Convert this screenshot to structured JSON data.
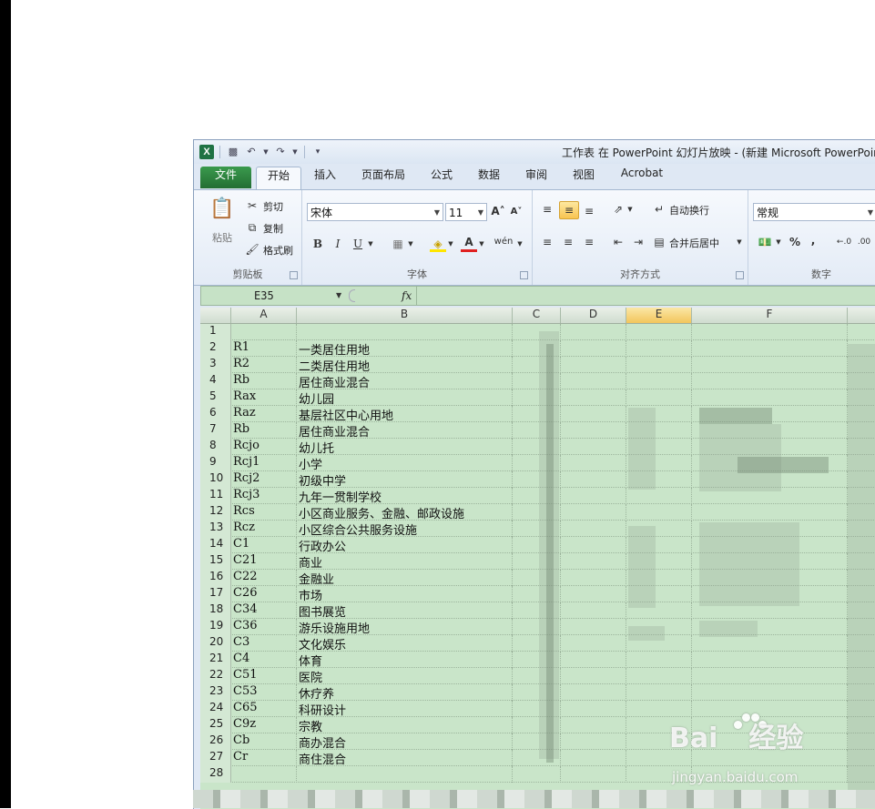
{
  "window": {
    "title": "工作表 在 PowerPoint 幻灯片放映 - (新建 Microsoft PowerPoint",
    "app_icon_letter": "X"
  },
  "qat": {
    "save_icon": "save-icon",
    "undo_icon": "undo-icon",
    "redo_icon": "redo-icon",
    "customize_icon": "customize-qat-icon"
  },
  "tabs": [
    "文件",
    "开始",
    "插入",
    "页面布局",
    "公式",
    "数据",
    "审阅",
    "视图",
    "Acrobat"
  ],
  "ribbon": {
    "clipboard": {
      "paste": "粘贴",
      "cut": "剪切",
      "copy": "复制",
      "format_painter": "格式刷",
      "label": "剪贴板"
    },
    "font": {
      "name": "宋体",
      "size": "11",
      "bold": "B",
      "italic": "I",
      "underline": "U",
      "label": "字体",
      "phonetic": "wén"
    },
    "alignment": {
      "wrap_text": "自动换行",
      "merge_center": "合并后居中",
      "label": "对齐方式"
    },
    "number": {
      "format": "常规",
      "percent": "%",
      "comma": ",",
      "label": "数字"
    }
  },
  "formula_bar": {
    "name_box": "E35",
    "fx": "fx",
    "formula": ""
  },
  "columns": [
    "A",
    "B",
    "C",
    "D",
    "E",
    "F"
  ],
  "selected_column": "E",
  "rows": [
    {
      "n": "1",
      "a": "",
      "b": ""
    },
    {
      "n": "2",
      "a": "R1",
      "b": "一类居住用地"
    },
    {
      "n": "3",
      "a": "R2",
      "b": "二类居住用地"
    },
    {
      "n": "4",
      "a": "Rb",
      "b": "居住商业混合"
    },
    {
      "n": "5",
      "a": "Rax",
      "b": "幼儿园"
    },
    {
      "n": "6",
      "a": "Raz",
      "b": "基层社区中心用地"
    },
    {
      "n": "7",
      "a": "Rb",
      "b": "居住商业混合"
    },
    {
      "n": "8",
      "a": "Rcjo",
      "b": "幼儿托"
    },
    {
      "n": "9",
      "a": "Rcj1",
      "b": "小学"
    },
    {
      "n": "10",
      "a": "Rcj2",
      "b": "初级中学"
    },
    {
      "n": "11",
      "a": "Rcj3",
      "b": "九年一贯制学校"
    },
    {
      "n": "12",
      "a": "Rcs",
      "b": "小区商业服务、金融、邮政设施"
    },
    {
      "n": "13",
      "a": "Rcz",
      "b": "小区综合公共服务设施"
    },
    {
      "n": "14",
      "a": "C1",
      "b": "行政办公"
    },
    {
      "n": "15",
      "a": "C21",
      "b": "商业"
    },
    {
      "n": "16",
      "a": "C22",
      "b": "金融业"
    },
    {
      "n": "17",
      "a": "C26",
      "b": "市场"
    },
    {
      "n": "18",
      "a": "C34",
      "b": "图书展览"
    },
    {
      "n": "19",
      "a": "C36",
      "b": "游乐设施用地"
    },
    {
      "n": "20",
      "a": "C3",
      "b": "文化娱乐"
    },
    {
      "n": "21",
      "a": "C4",
      "b": "体育"
    },
    {
      "n": "22",
      "a": "C51",
      "b": "医院"
    },
    {
      "n": "23",
      "a": "C53",
      "b": "休疗养"
    },
    {
      "n": "24",
      "a": "C65",
      "b": "科研设计"
    },
    {
      "n": "25",
      "a": "C9z",
      "b": "宗教"
    },
    {
      "n": "26",
      "a": "Cb",
      "b": "商办混合"
    },
    {
      "n": "27",
      "a": "Cr",
      "b": "商住混合"
    },
    {
      "n": "28",
      "a": "",
      "b": ""
    }
  ],
  "watermark": {
    "brand": "Bai",
    "brand2": "经验",
    "url": "jingyan.baidu.com"
  },
  "colors": {
    "grid_bg": "#c9e5c9",
    "selected_header": "#f2c55c",
    "file_tab": "#2b7d3c"
  }
}
